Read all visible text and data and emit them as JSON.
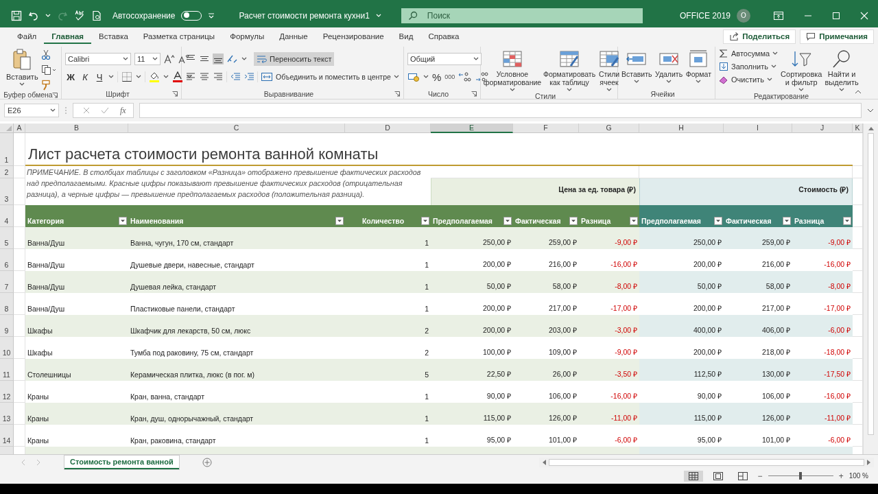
{
  "titlebar": {
    "autosave": {
      "label": "Автосохранение",
      "on": false
    },
    "document_title": "Расчет стоимости ремонта кухни1",
    "search": {
      "placeholder": "Поиск"
    },
    "account": "OFFICE 2019",
    "user_initial": "O"
  },
  "ribbon_tabs": [
    {
      "label": "Файл",
      "selected": false
    },
    {
      "label": "Главная",
      "selected": true
    },
    {
      "label": "Вставка",
      "selected": false
    },
    {
      "label": "Разметка страницы",
      "selected": false
    },
    {
      "label": "Формулы",
      "selected": false
    },
    {
      "label": "Данные",
      "selected": false
    },
    {
      "label": "Рецензирование",
      "selected": false
    },
    {
      "label": "Вид",
      "selected": false
    },
    {
      "label": "Справка",
      "selected": false
    }
  ],
  "share_button": "Поделиться",
  "comments_button": "Примечания",
  "ribbon": {
    "clipboard": {
      "label": "Буфер обмена",
      "paste": "Вставить"
    },
    "font": {
      "label": "Шрифт",
      "font_name": "Calibri",
      "font_size": "11",
      "bold": "Ж",
      "italic": "К",
      "underline": "Ч"
    },
    "alignment": {
      "label": "Выравнивание",
      "vertical": [
        {
          "selected": false
        },
        {
          "selected": false
        },
        {
          "selected": true
        }
      ],
      "wrap_text": {
        "label": "Переносить текст",
        "selected": true
      },
      "merge": "Объединить и поместить в центре"
    },
    "number": {
      "label": "Число",
      "format": "Общий",
      "percent": "%",
      "thousands": "000"
    },
    "styles": {
      "label": "Стили",
      "buttons": [
        "Условное форматирование",
        "Форматировать как таблицу",
        "Стили ячеек"
      ]
    },
    "cells": {
      "label": "Ячейки",
      "buttons": [
        "Вставить",
        "Удалить",
        "Формат"
      ]
    },
    "editing": {
      "label": "Редактирование",
      "small": [
        "Автосумма",
        "Заполнить",
        "Очистить"
      ],
      "buttons": [
        "Сортировка и фильтр",
        "Найти и выделить"
      ]
    }
  },
  "formula_bar": {
    "name_box": "E26",
    "fx": "fx"
  },
  "column_headers": [
    {
      "label": "A",
      "selected": false
    },
    {
      "label": "B",
      "selected": false
    },
    {
      "label": "C",
      "selected": false
    },
    {
      "label": "D",
      "selected": false
    },
    {
      "label": "E",
      "selected": true
    },
    {
      "label": "F",
      "selected": false
    },
    {
      "label": "G",
      "selected": false
    },
    {
      "label": "H",
      "selected": false
    },
    {
      "label": "I",
      "selected": false
    },
    {
      "label": "J",
      "selected": false
    },
    {
      "label": "K",
      "selected": false
    }
  ],
  "row_numbers": [
    "1",
    "2",
    "3",
    "4",
    "5",
    "6",
    "7",
    "8",
    "9",
    "10",
    "11",
    "12",
    "13",
    "14"
  ],
  "sheet": {
    "title": "Лист расчета стоимости ремонта ванной комнаты",
    "note": "ПРИМЕЧАНИЕ. В столбцах таблицы с заголовком «Разница» отображено превышение фактических расходов над предполагаемыми. Красные цифры показывают превышение фактических расходов (отрицательная разница), а черные цифры — превышение предполагаемых расходов (положительная разница).",
    "group_headers": [
      "Цена за ед. товара (₽)",
      "Стоимость (₽)"
    ],
    "columns": [
      "Категория",
      "Наименования",
      "Количество",
      "Предполагаемая",
      "Фактическая",
      "Разница",
      "Предполагаемая",
      "Фактическая",
      "Разница"
    ]
  },
  "rows": [
    {
      "category": "Ванна/Душ",
      "name": "Ванна, чугун, 170 см, стандарт",
      "qty": "1",
      "unit_est": "250,00 ₽",
      "unit_act": "259,00 ₽",
      "unit_diff": "-9,00 ₽",
      "cost_est": "250,00 ₽",
      "cost_act": "259,00 ₽",
      "cost_diff": "-9,00 ₽",
      "over_budget": true
    },
    {
      "category": "Ванна/Душ",
      "name": "Душевые двери, навесные, стандарт",
      "qty": "1",
      "unit_est": "200,00 ₽",
      "unit_act": "216,00 ₽",
      "unit_diff": "-16,00 ₽",
      "cost_est": "200,00 ₽",
      "cost_act": "216,00 ₽",
      "cost_diff": "-16,00 ₽",
      "over_budget": true
    },
    {
      "category": "Ванна/Душ",
      "name": "Душевая лейка, стандарт",
      "qty": "1",
      "unit_est": "50,00 ₽",
      "unit_act": "58,00 ₽",
      "unit_diff": "-8,00 ₽",
      "cost_est": "50,00 ₽",
      "cost_act": "58,00 ₽",
      "cost_diff": "-8,00 ₽",
      "over_budget": true
    },
    {
      "category": "Ванна/Душ",
      "name": "Пластиковые панели, стандарт",
      "qty": "1",
      "unit_est": "200,00 ₽",
      "unit_act": "217,00 ₽",
      "unit_diff": "-17,00 ₽",
      "cost_est": "200,00 ₽",
      "cost_act": "217,00 ₽",
      "cost_diff": "-17,00 ₽",
      "over_budget": true
    },
    {
      "category": "Шкафы",
      "name": "Шкафчик для лекарств, 50 см, люкс",
      "qty": "2",
      "unit_est": "200,00 ₽",
      "unit_act": "203,00 ₽",
      "unit_diff": "-3,00 ₽",
      "cost_est": "400,00 ₽",
      "cost_act": "406,00 ₽",
      "cost_diff": "-6,00 ₽",
      "over_budget": true
    },
    {
      "category": "Шкафы",
      "name": "Тумба под раковину, 75 см, стандарт",
      "qty": "2",
      "unit_est": "100,00 ₽",
      "unit_act": "109,00 ₽",
      "unit_diff": "-9,00 ₽",
      "cost_est": "200,00 ₽",
      "cost_act": "218,00 ₽",
      "cost_diff": "-18,00 ₽",
      "over_budget": true
    },
    {
      "category": "Столешницы",
      "name": "Керамическая плитка, люкс (в пог. м)",
      "qty": "5",
      "unit_est": "22,50 ₽",
      "unit_act": "26,00 ₽",
      "unit_diff": "-3,50 ₽",
      "cost_est": "112,50 ₽",
      "cost_act": "130,00 ₽",
      "cost_diff": "-17,50 ₽",
      "over_budget": true
    },
    {
      "category": "Краны",
      "name": "Кран, ванна, стандарт",
      "qty": "1",
      "unit_est": "90,00 ₽",
      "unit_act": "106,00 ₽",
      "unit_diff": "-16,00 ₽",
      "cost_est": "90,00 ₽",
      "cost_act": "106,00 ₽",
      "cost_diff": "-16,00 ₽",
      "over_budget": true
    },
    {
      "category": "Краны",
      "name": "Кран, душ, однорычажный, стандарт",
      "qty": "1",
      "unit_est": "115,00 ₽",
      "unit_act": "126,00 ₽",
      "unit_diff": "-11,00 ₽",
      "cost_est": "115,00 ₽",
      "cost_act": "126,00 ₽",
      "cost_diff": "-11,00 ₽",
      "over_budget": true
    },
    {
      "category": "Краны",
      "name": "Кран, раковина, стандарт",
      "qty": "1",
      "unit_est": "95,00 ₽",
      "unit_act": "101,00 ₽",
      "unit_diff": "-6,00 ₽",
      "cost_est": "95,00 ₽",
      "cost_act": "101,00 ₽",
      "cost_diff": "-6,00 ₽",
      "over_budget": true
    }
  ],
  "sheet_tabs": [
    {
      "label": "Стоимость ремонта ванной",
      "selected": true
    }
  ],
  "status_bar": {
    "views": [
      {
        "selected": true
      },
      {
        "selected": false
      },
      {
        "selected": false
      }
    ],
    "zoom_out": "−",
    "zoom_in": "+",
    "zoom": {
      "level": 0.5
    },
    "zoom_label": "100 %"
  }
}
